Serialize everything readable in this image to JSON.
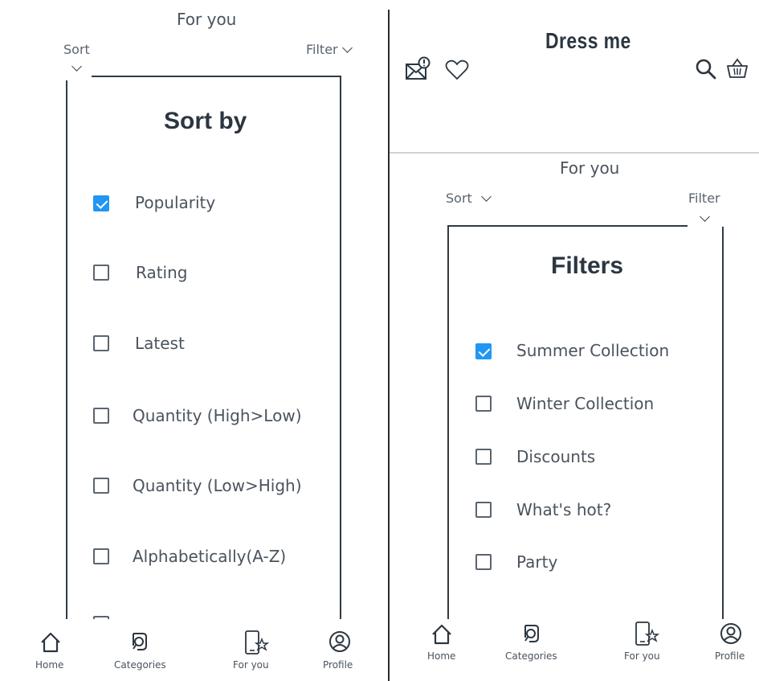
{
  "left": {
    "header_title": "For you",
    "sort_label": "Sort",
    "filter_label": "Filter",
    "sheet_title": "Sort by",
    "options": [
      {
        "label": "Popularity",
        "checked": true
      },
      {
        "label": "Rating",
        "checked": false
      },
      {
        "label": "Latest",
        "checked": false
      },
      {
        "label": "Quantity (High>Low)",
        "checked": false
      },
      {
        "label": "Quantity (Low>High)",
        "checked": false
      },
      {
        "label": "Alphabetically(A-Z)",
        "checked": false
      }
    ],
    "nav": [
      {
        "label": "Home",
        "icon": "home-icon"
      },
      {
        "label": "Categories",
        "icon": "categories-icon"
      },
      {
        "label": "For you",
        "icon": "for-you-icon"
      },
      {
        "label": "Profile",
        "icon": "profile-icon"
      }
    ]
  },
  "right": {
    "brand": "Dress me",
    "header_title": "For you",
    "sort_label": "Sort",
    "filter_label": "Filter",
    "sheet_title": "Filters",
    "options": [
      {
        "label": "Summer Collection",
        "checked": true
      },
      {
        "label": "Winter Collection",
        "checked": false
      },
      {
        "label": "Discounts",
        "checked": false
      },
      {
        "label": "What's hot?",
        "checked": false
      },
      {
        "label": "Party",
        "checked": false
      }
    ],
    "nav": [
      {
        "label": "Home",
        "icon": "home-icon"
      },
      {
        "label": "Categories",
        "icon": "categories-icon"
      },
      {
        "label": "For you",
        "icon": "for-you-icon"
      },
      {
        "label": "Profile",
        "icon": "profile-icon"
      }
    ]
  },
  "colors": {
    "accent": "#2196f3",
    "text": "#4a535d",
    "border": "#2f3a45"
  }
}
